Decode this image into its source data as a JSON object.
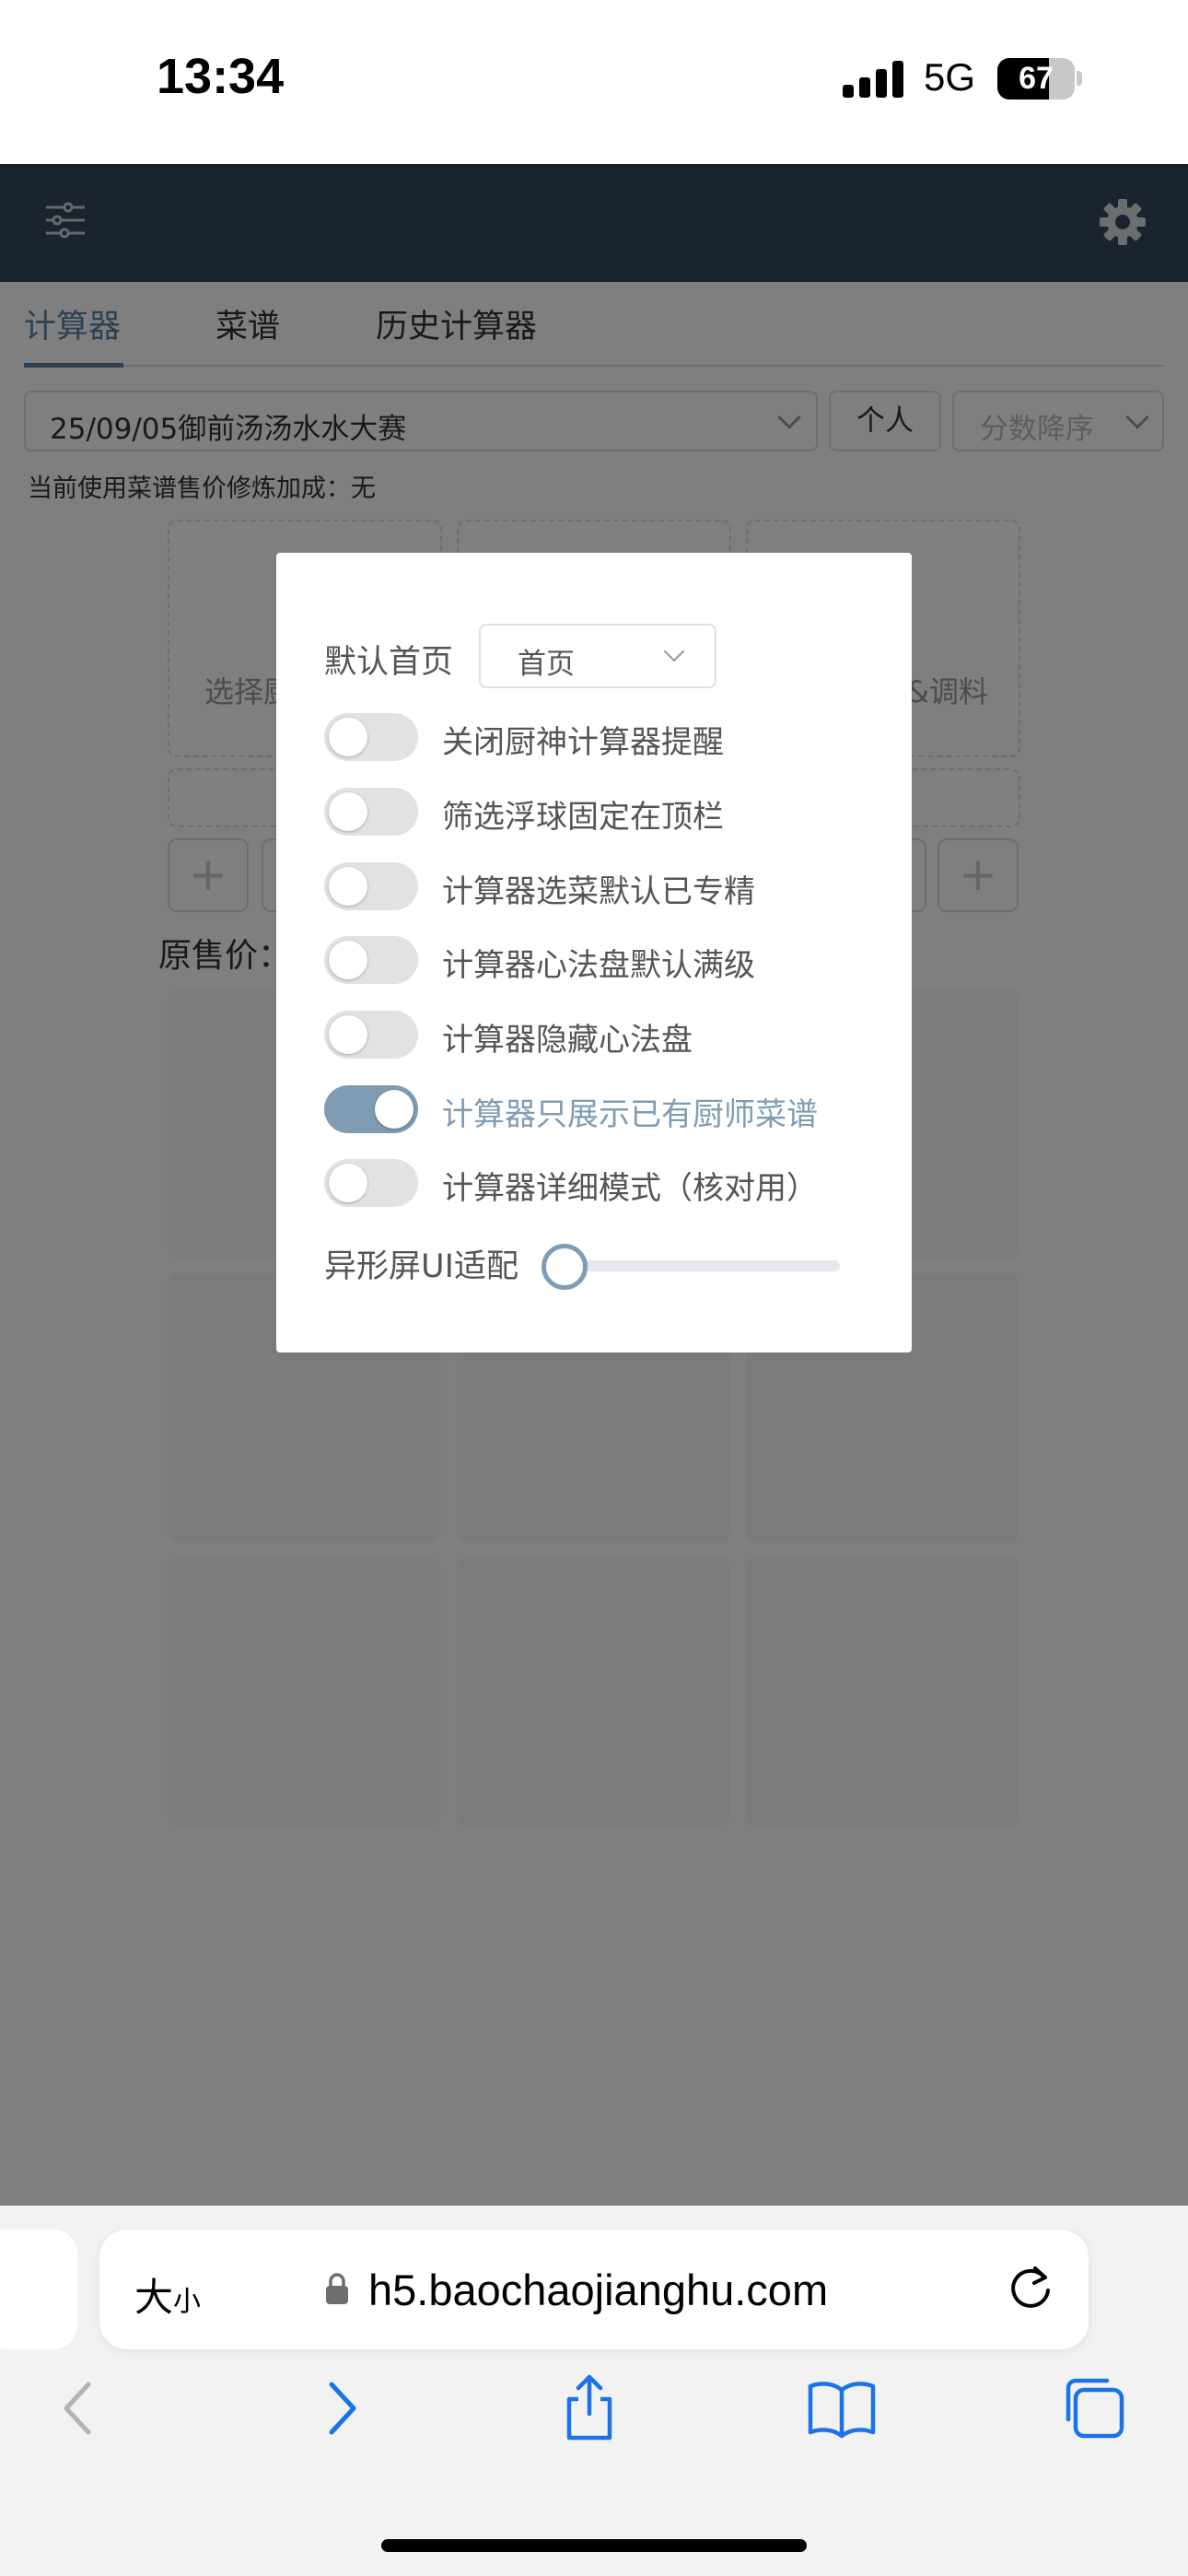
{
  "status_bar": {
    "time": "13:34",
    "network": "5G",
    "battery": "67"
  },
  "tabs": [
    {
      "label": "计算器"
    },
    {
      "label": "菜谱"
    },
    {
      "label": "历史计算器"
    }
  ],
  "filters": {
    "contest": "25/09/05御前汤汤水水大赛",
    "personal_button": "个人",
    "sort": "分数降序",
    "bonus_text": "当前使用菜谱售价修炼加成：无"
  },
  "background": {
    "choose_chef_text": "选择厨",
    "condiment_text": "&调料",
    "original_price_label": "原售价："
  },
  "modal": {
    "default_home_label": "默认首页",
    "default_home_value": "首页",
    "toggles": [
      {
        "label": "关闭厨神计算器提醒",
        "on": false
      },
      {
        "label": "筛选浮球固定在顶栏",
        "on": false
      },
      {
        "label": "计算器选菜默认已专精",
        "on": false
      },
      {
        "label": "计算器心法盘默认满级",
        "on": false
      },
      {
        "label": "计算器隐藏心法盘",
        "on": false
      },
      {
        "label": "计算器只展示已有厨师菜谱",
        "on": true
      },
      {
        "label": "计算器详细模式（核对用）",
        "on": false
      }
    ],
    "slider_label": "异形屏UI适配",
    "slider_value": 0
  },
  "browser": {
    "text_size_big": "大",
    "text_size_small": "小",
    "url": "h5.baochaojianghu.com"
  },
  "colors": {
    "header": "#34495e",
    "accent": "#7f9cb3",
    "tab_active": "#5b82a3"
  }
}
